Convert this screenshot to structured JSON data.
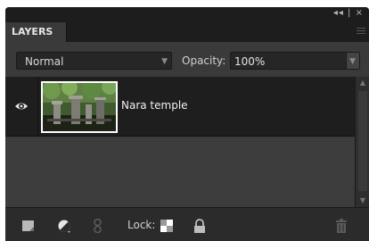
{
  "panel": {
    "collapse_glyph": "◂◂ | ×",
    "tab_label": "LAYERS"
  },
  "controls": {
    "blend_mode": "Normal",
    "opacity_label": "Opacity:",
    "opacity_value": "100%"
  },
  "layers": [
    {
      "name": "Nara temple",
      "visible": true,
      "icon": "eye-icon"
    }
  ],
  "toolbar": {
    "lock_label": "Lock:",
    "icons": [
      "new-layer-icon",
      "adjustment-layer-icon",
      "link-icon",
      "lock-transparency-icon",
      "lock-all-icon",
      "trash-icon"
    ]
  }
}
